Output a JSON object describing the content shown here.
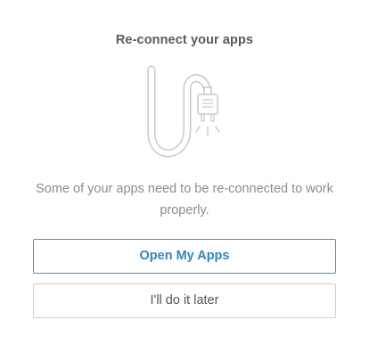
{
  "dialog": {
    "title": "Re-connect your apps",
    "illustration_icon": "unplugged-cable-icon",
    "message": "Some of your apps need to be re-connected to work properly.",
    "primary_button_label": "Open My Apps",
    "secondary_button_label": "I'll do it later"
  },
  "colors": {
    "primary_accent": "#2f86c9",
    "title_text": "#5a5a5a",
    "body_text": "#8c8c8c",
    "secondary_border": "#cfcfcf"
  }
}
